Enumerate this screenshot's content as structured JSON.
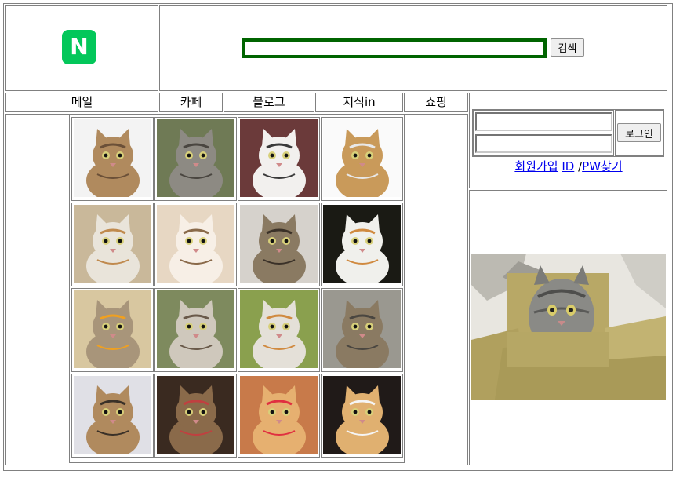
{
  "logo": {
    "letter": "N",
    "color": "#03c75a",
    "icon": "naver-logo-icon"
  },
  "search": {
    "value": "",
    "placeholder": "",
    "button_label": "검색",
    "border_color": "#006400"
  },
  "nav": {
    "items": [
      "메일",
      "카페",
      "블로그",
      "지식in",
      "쇼핑"
    ]
  },
  "login": {
    "id_value": "",
    "pw_value": "",
    "button_label": "로그인",
    "signup_label": "회원가입",
    "id_link": "ID",
    "separator": " /",
    "pw_link": "PW찾기"
  },
  "gallery": {
    "rows": 4,
    "cols": 4,
    "items": [
      "kitten-waving-photo",
      "tabby-cat-photo",
      "white-cat-face-photo",
      "cat-in-lab-coat-photo",
      "cat-in-box-photo",
      "fluffy-cat-closeup-photo",
      "hissing-tabby-photo",
      "calico-cat-photo",
      "cat-with-flower-photo",
      "fluffy-cat-walking-photo",
      "calico-lying-photo",
      "tabby-portrait-photo",
      "bengal-cat-photo",
      "cat-screaming-photo",
      "cat-with-lollipop-photo",
      "orange-white-cat-photo"
    ]
  },
  "ad": {
    "image": "cat-in-cardboard-box-photo"
  }
}
